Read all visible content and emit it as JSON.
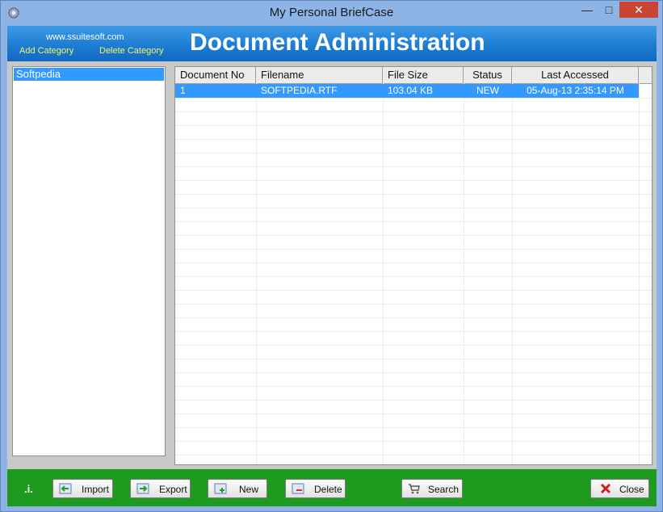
{
  "window": {
    "title": "My Personal BriefCase"
  },
  "header": {
    "site_link": "www.ssuitesoft.com",
    "add_category": "Add Category",
    "delete_category": "Delete Category",
    "title": "Document Administration"
  },
  "categories": {
    "items": [
      "Softpedia"
    ]
  },
  "table": {
    "columns": [
      "Document No",
      "Filename",
      "File Size",
      "Status",
      "Last Accessed"
    ],
    "rows": [
      {
        "doc_no": "1",
        "filename": "SOFTPEDIA.RTF",
        "size": "103.04 KB",
        "status": "NEW",
        "accessed": "05-Aug-13 2:35:14 PM"
      }
    ]
  },
  "footer": {
    "info": ".i.",
    "import": "Import",
    "export": "Export",
    "new": "New",
    "delete": "Delete",
    "search": "Search",
    "close": "Close"
  },
  "colors": {
    "header_blue": "#1d7dd2",
    "footer_green": "#1e9b1e",
    "selection": "#3399ff",
    "link_yellow": "#f3f36a"
  }
}
